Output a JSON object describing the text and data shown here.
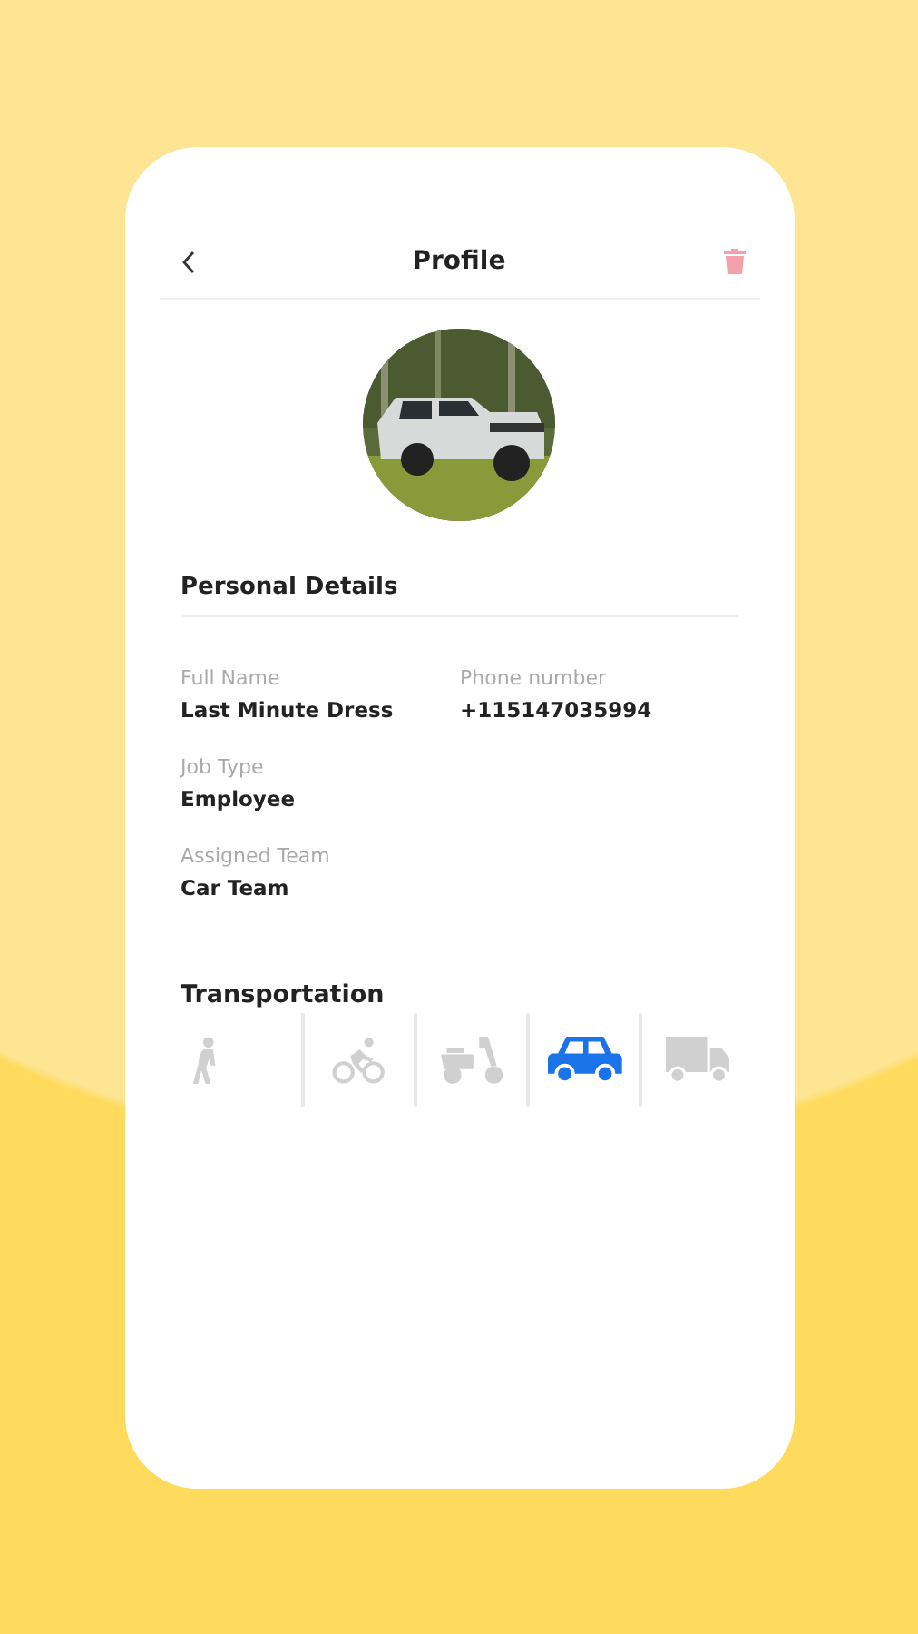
{
  "header": {
    "title": "Profile"
  },
  "personal_details": {
    "title": "Personal Details",
    "rows": [
      [
        {
          "label": "Full Name",
          "value": "Last Minute Dress"
        },
        {
          "label": "Phone number",
          "value": "+115147035994"
        }
      ],
      [
        {
          "label": "Job Type",
          "value": "Employee"
        }
      ],
      [
        {
          "label": "Assigned Team",
          "value": "Car Team"
        }
      ]
    ]
  },
  "transportation": {
    "title": "Transportation",
    "modes": [
      {
        "kind": "walk",
        "selected": false
      },
      {
        "kind": "bike",
        "selected": false
      },
      {
        "kind": "scooter",
        "selected": false
      },
      {
        "kind": "car",
        "selected": true
      },
      {
        "kind": "truck",
        "selected": false
      }
    ]
  }
}
